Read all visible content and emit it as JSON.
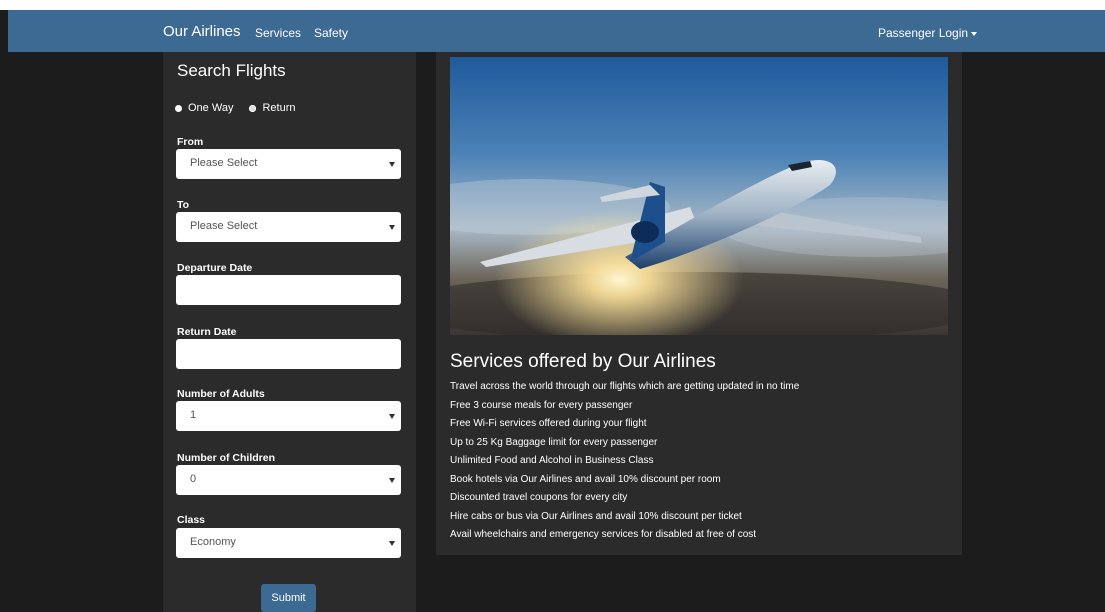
{
  "nav": {
    "brand": "Our Airlines",
    "links": [
      "Services",
      "Safety"
    ],
    "login": "Passenger Login"
  },
  "search": {
    "title": "Search Flights",
    "trip_types": [
      {
        "label": "One Way",
        "selected": false
      },
      {
        "label": "Return",
        "selected": true
      }
    ],
    "fields": {
      "from": {
        "label": "From",
        "value": "Please Select"
      },
      "to": {
        "label": "To",
        "value": "Please Select"
      },
      "departure": {
        "label": "Departure Date",
        "value": ""
      },
      "return_date": {
        "label": "Return Date",
        "value": ""
      },
      "adults": {
        "label": "Number of Adults",
        "value": "1"
      },
      "children": {
        "label": "Number of Children",
        "value": "0"
      },
      "class": {
        "label": "Class",
        "value": "Economy"
      }
    },
    "submit": "Submit"
  },
  "services": {
    "title": "Services offered by Our Airlines",
    "items": [
      "Travel across the world through our flights which are getting updated in no time",
      "Free 3 course meals for every passenger",
      "Free Wi-Fi services offered during your flight",
      "Up to 25 Kg Baggage limit for every passenger",
      "Unlimited Food and Alcohol in Business Class",
      "Book hotels via Our Airlines and avail 10% discount per room",
      "Discounted travel coupons for every city",
      "Hire cabs or bus via Our Airlines and avail 10% discount per ticket",
      "Avail wheelchairs and emergency services for disabled at free of cost"
    ]
  },
  "colors": {
    "navbar": "#3c6a93",
    "background": "#1c1c1c",
    "panel": "#2b2b2b",
    "accent": "#3c6a93"
  },
  "icons": [
    "dropdown-caret-icon",
    "radio-icon",
    "select-arrow-icon"
  ]
}
